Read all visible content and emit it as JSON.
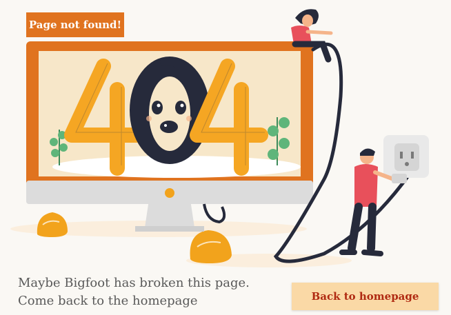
{
  "badge": {
    "label": "Page not found!"
  },
  "illustration": {
    "error_code": "404"
  },
  "message": {
    "line1": "Maybe Bigfoot has broken this page.",
    "line2": "Come back to the homepage"
  },
  "actions": {
    "home_label": "Back to homepage"
  },
  "colors": {
    "accent": "#e0731f",
    "button_bg": "#fad9a6",
    "button_text": "#b02a12",
    "digit": "#f5a623",
    "text": "#595959"
  }
}
